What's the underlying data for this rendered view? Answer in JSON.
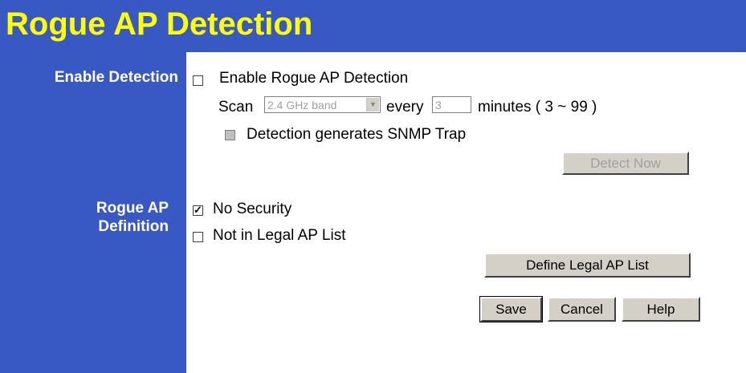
{
  "header": {
    "title": "Rogue AP Detection"
  },
  "sidebar": {
    "enable_detection": "Enable Detection",
    "rogue_ap_line1": "Rogue AP",
    "rogue_ap_line2": "Definition"
  },
  "detection": {
    "enable_label": "Enable Rogue AP Detection",
    "enable_checked": false,
    "scan_label": "Scan",
    "band_value": "2.4 GHz band",
    "every_label": "every",
    "interval_value": "3",
    "minutes_label": "minutes ( 3 ~ 99 )",
    "snmp_label": "Detection generates SNMP Trap",
    "snmp_checked": false,
    "detect_now_label": "Detect Now"
  },
  "definition": {
    "no_security_label": "No Security",
    "no_security_checked": true,
    "not_legal_label": "Not in Legal AP List",
    "not_legal_checked": false,
    "define_legal_label": "Define Legal AP List"
  },
  "actions": {
    "save_label": "Save",
    "cancel_label": "Cancel",
    "help_label": "Help"
  },
  "colors": {
    "panel_blue": "#3858c4",
    "title_yellow": "#ffff00"
  }
}
